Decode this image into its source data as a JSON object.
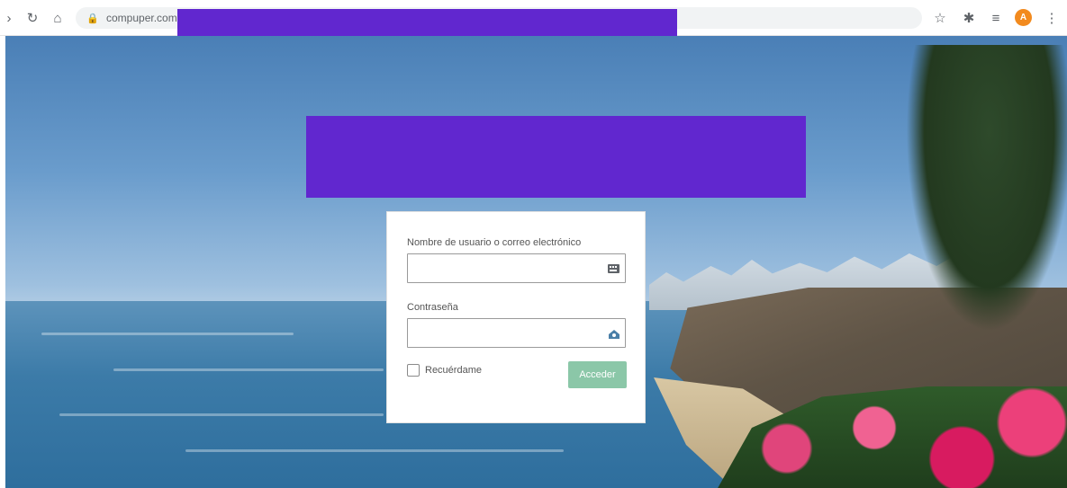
{
  "browser": {
    "url": "compuper.com",
    "icons": {
      "forward": "forward-icon",
      "reload": "reload-icon",
      "home": "home-icon",
      "lock": "lock-icon",
      "star": "star-icon",
      "extensions": "puzzle-icon",
      "reading_list": "reading-list-icon",
      "menu": "kebab-menu-icon"
    },
    "avatar_initial": "A"
  },
  "login": {
    "username_label": "Nombre de usuario o correo electrónico",
    "username_value": "",
    "password_label": "Contraseña",
    "password_value": "",
    "remember_label": "Recuérdame",
    "remember_checked": false,
    "submit_label": "Acceder"
  },
  "colors": {
    "redaction": "#6127cf",
    "button": "#8bc7a8",
    "avatar": "#f28a1e"
  }
}
